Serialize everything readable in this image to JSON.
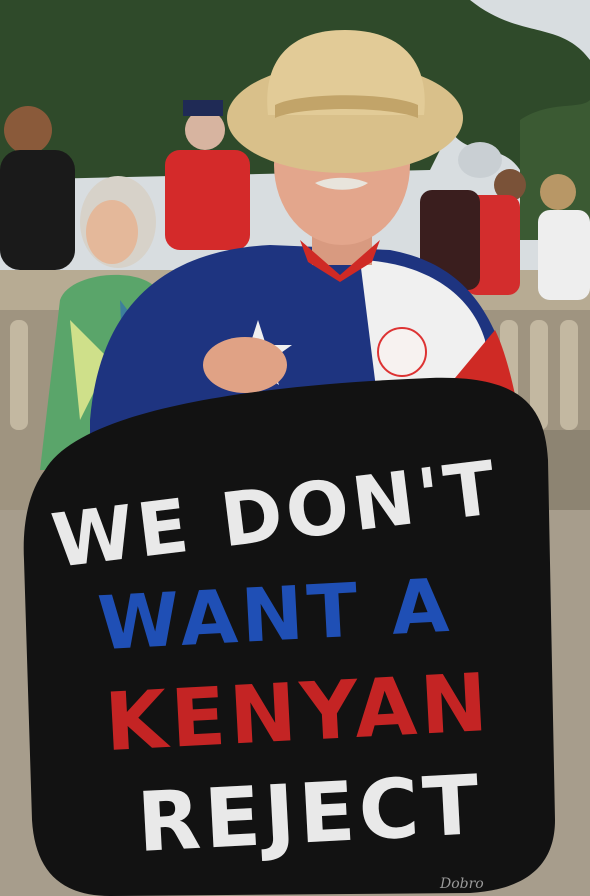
{
  "sign": {
    "line1": "WE DON'T",
    "line2": "WANT A",
    "line3": "KENYAN",
    "line4": "REJECT",
    "signature": "Dobro"
  },
  "colors": {
    "sign_background": "#121212",
    "text_white": "#e9e9e9",
    "text_blue": "#1f4fb5",
    "text_red": "#c42424",
    "shirt_blue": "#1e3480",
    "shirt_red": "#cf2a25",
    "shirt_white": "#f0f0f0",
    "hat_straw": "#d9c08a",
    "foliage": "#2f4a2a",
    "sky": "#d8dde0"
  }
}
